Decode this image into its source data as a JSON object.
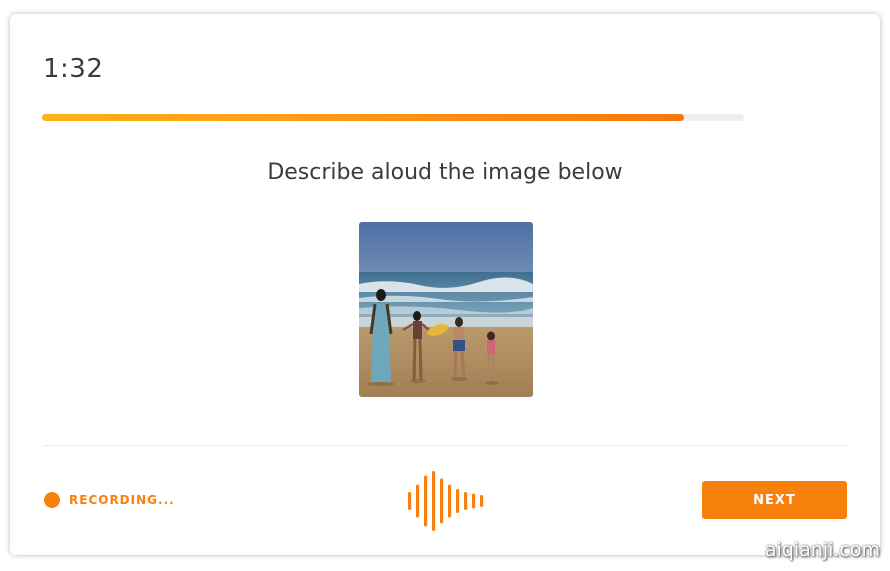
{
  "timer": {
    "value": "1:32"
  },
  "progress": {
    "fraction": 0.915,
    "colors": [
      "#ffb21a",
      "#f9770d"
    ]
  },
  "prompt": {
    "text": "Describe aloud the image below"
  },
  "image": {
    "subject": "family-walking-on-beach-photo"
  },
  "recording": {
    "label": "RECORDING...",
    "dot_color": "#f8810e"
  },
  "waveform": {
    "icon": "audio-waveform-icon",
    "levels": [
      0.3,
      0.55,
      0.85,
      1.0,
      0.75,
      0.55,
      0.4,
      0.3,
      0.25,
      0.2
    ]
  },
  "actions": {
    "next_label": "NEXT"
  },
  "watermark": {
    "text": "aiqianji.com"
  },
  "theme": {
    "accent": "#f8810e",
    "text": "#3c3c3c"
  }
}
